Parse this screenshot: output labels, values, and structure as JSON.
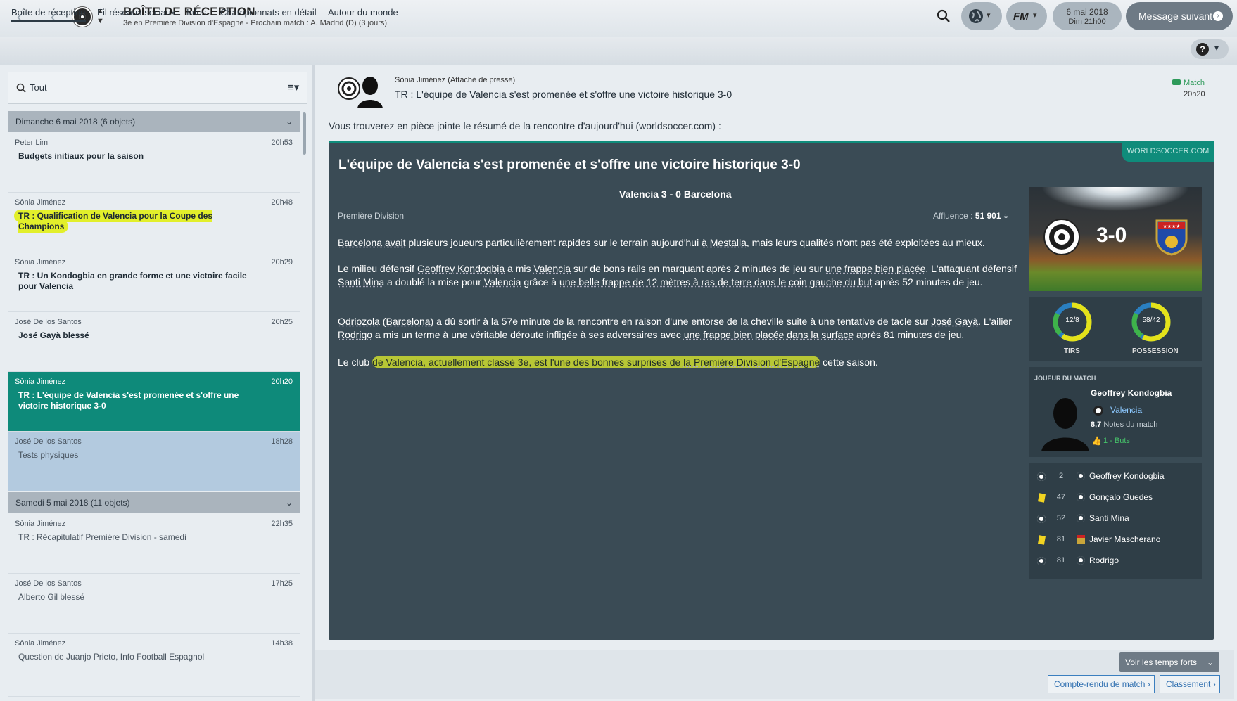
{
  "header": {
    "title": "BOÎTE DE RÉCEPTION",
    "subtitle": "3e en Première Division d'Espagne - Prochain match : A. Madrid (D) (3 jours)",
    "date_line1": "6 mai 2018",
    "date_line2": "Dim 21h00",
    "next_message": "Message suivant",
    "fm_label": "FM"
  },
  "tabs": [
    "Boîte de réception",
    "Fil réseaux sociaux",
    "Infos",
    "Championnats en détail",
    "Autour du monde"
  ],
  "inbox": {
    "filter": "Tout",
    "groups": [
      {
        "label": "Dimanche 6 mai 2018 (6 objets)"
      },
      {
        "label": "Samedi 5 mai 2018 (11 objets)"
      }
    ],
    "messages": [
      {
        "sender": "Peter Lim",
        "time": "20h53",
        "subject": "Budgets initiaux pour la saison"
      },
      {
        "sender": "Sònia Jiménez",
        "time": "20h48",
        "subject": "TR : Qualification de Valencia pour la Coupe des Champions"
      },
      {
        "sender": "Sònia Jiménez",
        "time": "20h29",
        "subject": "TR : Un Kondogbia en grande forme et une victoire facile pour Valencia"
      },
      {
        "sender": "José De los Santos",
        "time": "20h25",
        "subject": "José Gayà blessé"
      },
      {
        "sender": "Sònia Jiménez",
        "time": "20h20",
        "subject": "TR : L'équipe de Valencia s'est promenée et s'offre une victoire historique 3-0"
      },
      {
        "sender": "José De los Santos",
        "time": "18h28",
        "subject": "Tests physiques"
      },
      {
        "sender": "Sònia Jiménez",
        "time": "22h35",
        "subject": "TR : Récapitulatif Première Division - samedi"
      },
      {
        "sender": "José De los Santos",
        "time": "17h25",
        "subject": "Alberto Gil blessé"
      },
      {
        "sender": "Sònia Jiménez",
        "time": "14h38",
        "subject": "Question de Juanjo Prieto, Info Football Espagnol"
      }
    ]
  },
  "message": {
    "from": "Sònia Jiménez  (Attaché de presse)",
    "subject": "TR : L'équipe de Valencia s'est promenée et s'offre une victoire historique 3-0",
    "tag": "Match",
    "time": "20h20",
    "intro": "Vous trouverez en pièce jointe le résumé de la rencontre d'aujourd'hui (worldsoccer.com) :"
  },
  "article": {
    "source": "WORLDSOCCER.COM",
    "title": "L'équipe de Valencia s'est promenée et s'offre une victoire historique 3-0",
    "score_line": "Valencia 3 - 0  Barcelona",
    "league": "Première Division",
    "attendance_label": "Affluence :",
    "attendance": "51 901",
    "p1": {
      "a": "Barcelona",
      "b": "avait",
      "c": " plusieurs joueurs particulièrement rapides sur le terrain aujourd'hui ",
      "d": "à Mestalla",
      "e": ", mais leurs qualités n'ont pas été exploitées au mieux."
    },
    "p2": {
      "a": "Le milieu défensif ",
      "b": "Geoffrey Kondogbia",
      "c": " a mis ",
      "d": "Valencia",
      "e": " sur de bons rails en marquant après 2 minutes de jeu sur ",
      "f": "une frappe bien placée",
      "g": ". L'attaquant défensif ",
      "h": "Santi Mina",
      "i": " a doublé la mise pour ",
      "j": "Valencia",
      "k": " grâce à ",
      "l": "une belle frappe de 12 mètres à ras de terre dans le coin gauche du but",
      "m": " après 52 minutes de jeu."
    },
    "p3": {
      "a": "Odriozola",
      "b": " (",
      "c": "Barcelona",
      "d": ") a dû sortir à la 57e minute de la rencontre en raison d'une entorse de la cheville suite à une tentative de tacle sur ",
      "e": "José Gayà",
      "f": ". L'ailier ",
      "g": "Rodrigo",
      "h": " a mis un terme à une véritable déroute infligée à ses adversaires avec ",
      "i": "une frappe bien placée dans la surface",
      "j": " après 81 minutes de jeu."
    },
    "p4": {
      "a": "Le club ",
      "b": "de Valencia, actuellement classé 3e, est l'une des bonnes surprises de ",
      "c": "la Première Division d'Espagne",
      "d": " cette saison."
    }
  },
  "match_widget": {
    "score": "3-0",
    "shots": "12/8",
    "shots_label": "TIRS",
    "possession": "58/42",
    "possession_label": "POSSESSION"
  },
  "motm": {
    "heading": "JOUEUR DU MATCH",
    "name": "Geoffrey Kondogbia",
    "club": "Valencia",
    "rating": "8,7",
    "rating_label": "Notes du match",
    "goals": "1 - Buts"
  },
  "events": [
    {
      "type": "goal-icon",
      "minute": "2",
      "player": "Geoffrey Kondogbia"
    },
    {
      "type": "yellow-card-icon",
      "minute": "47",
      "player": "Gonçalo Guedes"
    },
    {
      "type": "goal-icon",
      "minute": "52",
      "player": "Santi Mina"
    },
    {
      "type": "yellow-card-icon",
      "minute": "81",
      "player": "Javier Mascherano"
    },
    {
      "type": "goal-icon",
      "minute": "81",
      "player": "Rodrigo"
    }
  ],
  "bottom": {
    "highlights": "Voir les temps forts",
    "report": "Compte-rendu de match",
    "standing": "Classement"
  },
  "colors": {
    "accent": "#0f8c7b",
    "card": "#3a4b55",
    "highlight": "#e2ef2b",
    "link": "#2f6fb0"
  }
}
